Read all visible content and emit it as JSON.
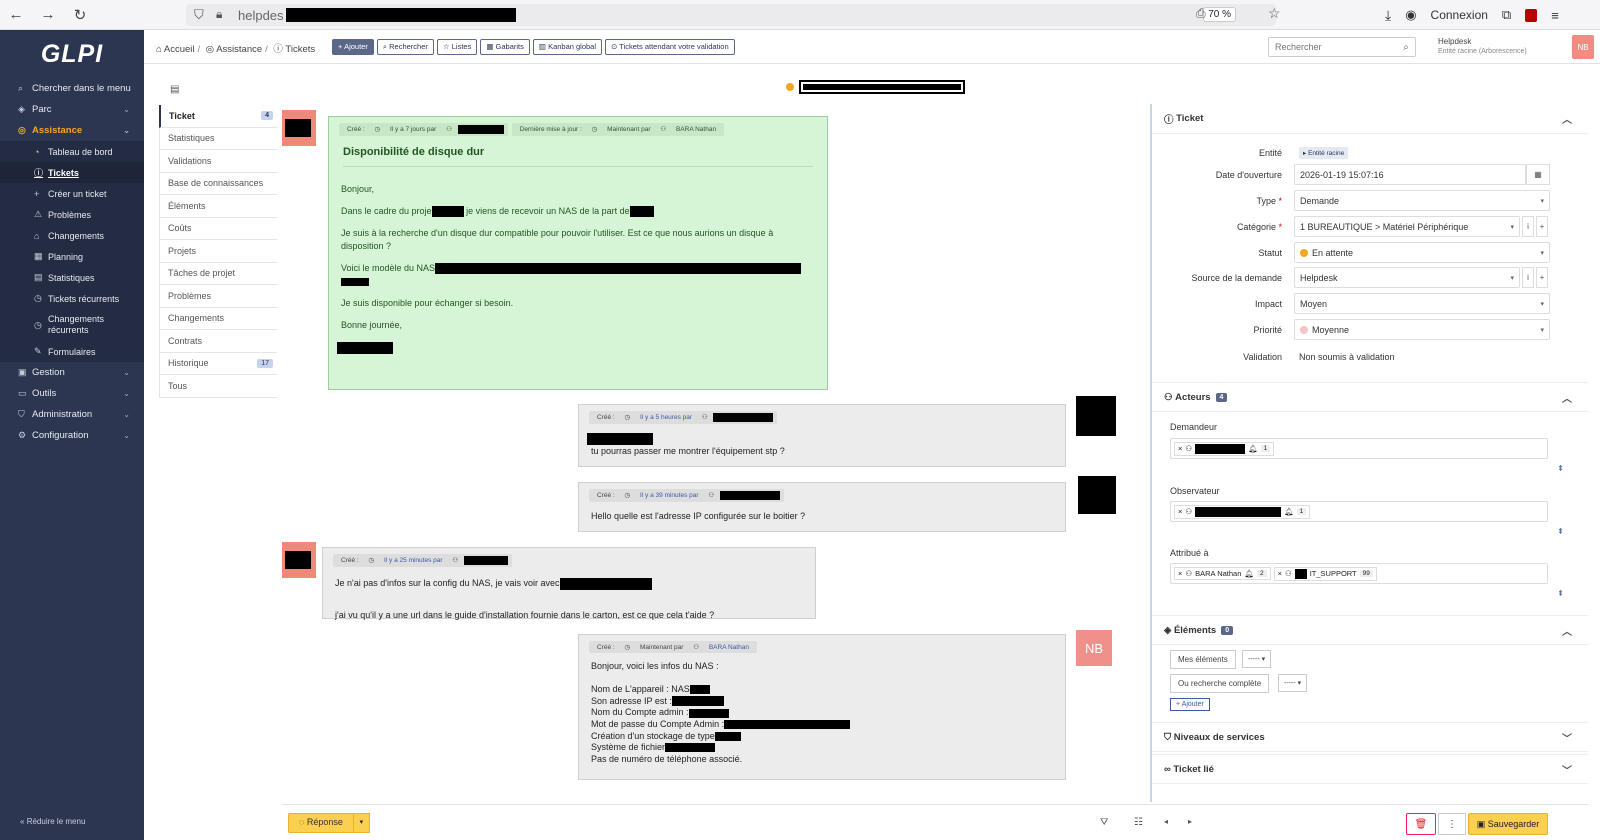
{
  "browser": {
    "url": "helpdes",
    "zoom": "70 %",
    "login": "Connexion",
    "icons": [
      "back-icon",
      "forward-icon",
      "reload-icon",
      "shield-icon",
      "lock-icon",
      "reader-icon",
      "star-icon",
      "download-icon",
      "account-icon",
      "extension-icon",
      "ublock-icon",
      "menu-icon"
    ]
  },
  "sidebar": {
    "logo": "GLPI",
    "items": [
      {
        "label": "Chercher dans le menu",
        "icon": "search-icon"
      },
      {
        "label": "Parc",
        "icon": "box-icon",
        "chevron": true
      },
      {
        "label": "Assistance",
        "icon": "lifebuoy-icon",
        "chevron": true,
        "active": true
      },
      {
        "label": "Gestion",
        "icon": "wallet-icon",
        "chevron": true
      },
      {
        "label": "Outils",
        "icon": "briefcase-icon",
        "chevron": true
      },
      {
        "label": "Administration",
        "icon": "shield-icon",
        "chevron": true
      },
      {
        "label": "Configuration",
        "icon": "gear-icon",
        "chevron": true
      }
    ],
    "assistance_sub": [
      "Tableau de bord",
      "Tickets",
      "Créer un ticket",
      "Problèmes",
      "Changements",
      "Planning",
      "Statistiques",
      "Tickets récurrents",
      "Changements récurrents",
      "Formulaires"
    ],
    "collapse": "Réduire le menu"
  },
  "header": {
    "breadcrumb": [
      "Accueil",
      "Assistance",
      "Tickets"
    ],
    "toolbar": [
      "Ajouter",
      "Rechercher",
      "Listes",
      "Gabarits",
      "Kanban global",
      "Tickets attendant votre validation"
    ],
    "search_placeholder": "Rechercher",
    "profile": "Helpdesk",
    "entity": "Entité racine (Arborescence)",
    "avatar": "NB"
  },
  "tabs": [
    {
      "label": "Ticket",
      "badge": "4"
    },
    {
      "label": "Statistiques"
    },
    {
      "label": "Validations"
    },
    {
      "label": "Base de connaissances"
    },
    {
      "label": "Éléments"
    },
    {
      "label": "Coûts"
    },
    {
      "label": "Projets"
    },
    {
      "label": "Tâches de projet"
    },
    {
      "label": "Problèmes"
    },
    {
      "label": "Changements"
    },
    {
      "label": "Contrats"
    },
    {
      "label": "Historique",
      "badge": "17"
    },
    {
      "label": "Tous"
    }
  ],
  "main_message": {
    "created": "Créé :",
    "when": "Il y a 7 jours par",
    "updated": "Dernière mise à jour :",
    "maintained": "Maintenant par",
    "author": "BARA Nathan",
    "subject": "Disponibilité de disque dur",
    "p1": "Bonjour,",
    "p2a": "Dans le cadre du proje",
    "p2b": " je viens de recevoir un NAS de la part de",
    "p3": "Je suis à la recherche d'un disque dur compatible pour pouvoir l'utiliser. Est ce que nous aurions un disque à disposition ?",
    "p4": "Voici le modèle du NAS",
    "p5": "Je suis disponible pour échanger si besoin.",
    "p6": "Bonne journée,"
  },
  "followups": [
    {
      "created": "Créé :",
      "when": "Il y a 5 heures par",
      "text": "tu pourras passer me montrer l'équipement stp ?"
    },
    {
      "created": "Créé :",
      "when": "Il y a 39 minutes par",
      "text": "Hello quelle est l'adresse IP configurée sur le boitier ?"
    },
    {
      "created": "Créé :",
      "when": "Il y a 25 minutes par",
      "text1": "Je n'ai pas d'infos sur la config du NAS, je vais voir avec",
      "text2": "j'ai vu qu'il y a une url dans le guide d'installation fournie dans le carton, est ce que cela t'aide ?"
    },
    {
      "created": "Créé :",
      "when": "Maintenant par",
      "author": "BARA Nathan",
      "avatar": "NB",
      "lines": [
        "Bonjour, voici les infos du NAS :",
        "Nom de L'appareil : NAS",
        "Son adresse IP est :",
        "Nom du Compte admin :",
        "Mot de passe du Compte Admin :",
        "Création d'un stockage de type",
        "Système de fichier",
        "Pas de numéro de téléphone associé."
      ]
    }
  ],
  "panel": {
    "ticket_title": "Ticket",
    "fields": [
      {
        "label": "Entité",
        "value": "Entité racine"
      },
      {
        "label": "Date d'ouverture",
        "value": "2026-01-19 15:07:16"
      },
      {
        "label": "Type",
        "value": "Demande",
        "required": true
      },
      {
        "label": "Catégorie",
        "value": "1 BUREAUTIQUE > Matériel Périphérique",
        "required": true
      },
      {
        "label": "Statut",
        "value": "En attente"
      },
      {
        "label": "Source de la demande",
        "value": "Helpdesk"
      },
      {
        "label": "Impact",
        "value": "Moyen"
      },
      {
        "label": "Priorité",
        "value": "Moyenne"
      },
      {
        "label": "Validation",
        "value": "Non soumis à validation"
      }
    ],
    "actors_title": "Acteurs",
    "actors_count": "4",
    "demandeur": "Demandeur",
    "observateur": "Observateur",
    "attribue": "Attribué à",
    "assignee1": "BARA Nathan",
    "assignee1_n": "2",
    "assignee2": "IT_SUPPORT",
    "assignee2_n": "99",
    "demandeur_n": "1",
    "observateur_n": "1",
    "elements_title": "Éléments",
    "elements_count": "0",
    "mes_elements": "Mes éléments",
    "recherche": "Ou recherche complète",
    "dash": "-----",
    "ajouter": "Ajouter",
    "niveaux": "Niveaux de services",
    "lie": "Ticket lié"
  },
  "footer": {
    "reply": "Réponse",
    "save": "Sauvegarder"
  },
  "colors": {
    "sidebar": "#2c3650",
    "accent": "#f5a623",
    "main_msg": "#d6f5d6",
    "save": "#fbcf4f"
  }
}
